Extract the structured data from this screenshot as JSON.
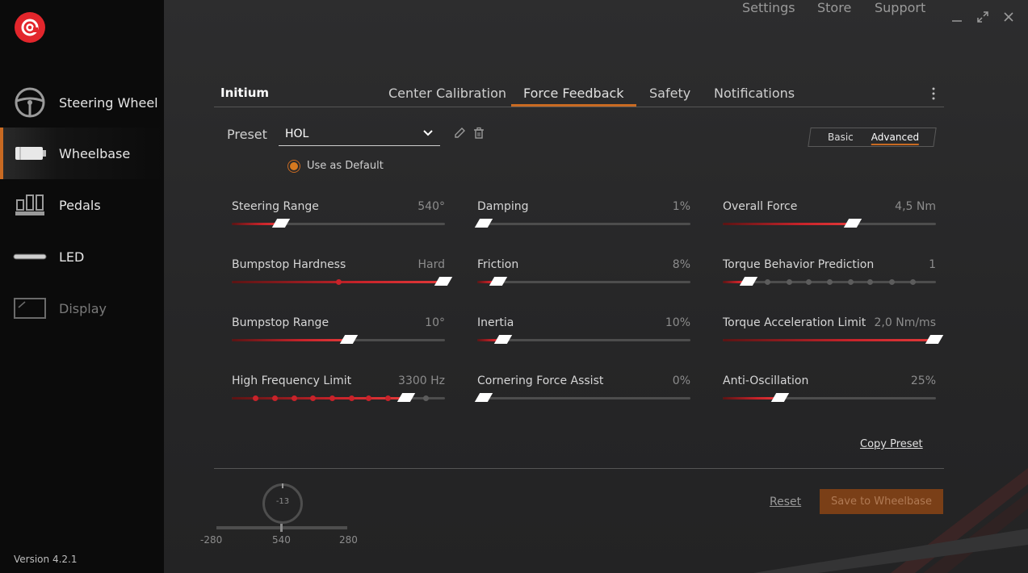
{
  "app": {
    "version": "Version 4.2.1",
    "accent": "#c96a22",
    "brand": "#e3262c"
  },
  "sidebar": {
    "items": [
      {
        "label": "Steering Wheel",
        "icon": "steering-wheel-icon"
      },
      {
        "label": "Wheelbase",
        "icon": "wheelbase-icon",
        "active": true
      },
      {
        "label": "Pedals",
        "icon": "pedals-icon"
      },
      {
        "label": "LED",
        "icon": "led-icon"
      },
      {
        "label": "Display",
        "icon": "display-icon",
        "dim": true
      }
    ]
  },
  "header": {
    "links": [
      "Settings",
      "Store",
      "Support"
    ]
  },
  "device": {
    "name": "Initium"
  },
  "tabs": [
    {
      "label": "Center Calibration"
    },
    {
      "label": "Force Feedback",
      "active": true
    },
    {
      "label": "Safety"
    },
    {
      "label": "Notifications"
    }
  ],
  "preset": {
    "label": "Preset",
    "value": "HOL",
    "use_default": "Use as Default"
  },
  "mode": {
    "basic": "Basic",
    "advanced": "Advanced",
    "selected": "Advanced"
  },
  "params": [
    {
      "label": "Steering Range",
      "value": "540°",
      "fraction": 0.23
    },
    {
      "label": "Damping",
      "value": "1%",
      "fraction": 0.03
    },
    {
      "label": "Overall Force",
      "value": "4,5 Nm",
      "fraction": 0.61
    },
    {
      "label": "Bumpstop Hardness",
      "value": "Hard",
      "fraction": 1.0,
      "ticks": [
        0.5
      ]
    },
    {
      "label": "Friction",
      "value": "8%",
      "fraction": 0.1
    },
    {
      "label": "Torque Behavior Prediction",
      "value": "1",
      "fraction": 0.12,
      "ticks": [
        0.12,
        0.21,
        0.31,
        0.4,
        0.5,
        0.6,
        0.69,
        0.79,
        0.89
      ]
    },
    {
      "label": "Bumpstop Range",
      "value": "10°",
      "fraction": 0.55
    },
    {
      "label": "Inertia",
      "value": "10%",
      "fraction": 0.12
    },
    {
      "label": "Torque Acceleration Limit",
      "value": "2,0 Nm/ms",
      "fraction": 1.0
    },
    {
      "label": "High Frequency Limit",
      "value": "3300 Hz",
      "fraction": 0.82,
      "ticks": [
        0.11,
        0.2,
        0.29,
        0.38,
        0.47,
        0.56,
        0.64,
        0.73,
        0.82,
        0.91
      ]
    },
    {
      "label": "Cornering Force Assist",
      "value": "0%",
      "fraction": 0.0
    },
    {
      "label": "Anti-Oscillation",
      "value": "25%",
      "fraction": 0.27
    }
  ],
  "copy_preset": "Copy Preset",
  "footer": {
    "angle": "-13",
    "range_left": "-280",
    "range_center": "540",
    "range_right": "280",
    "reset": "Reset",
    "save": "Save to Wheelbase"
  }
}
